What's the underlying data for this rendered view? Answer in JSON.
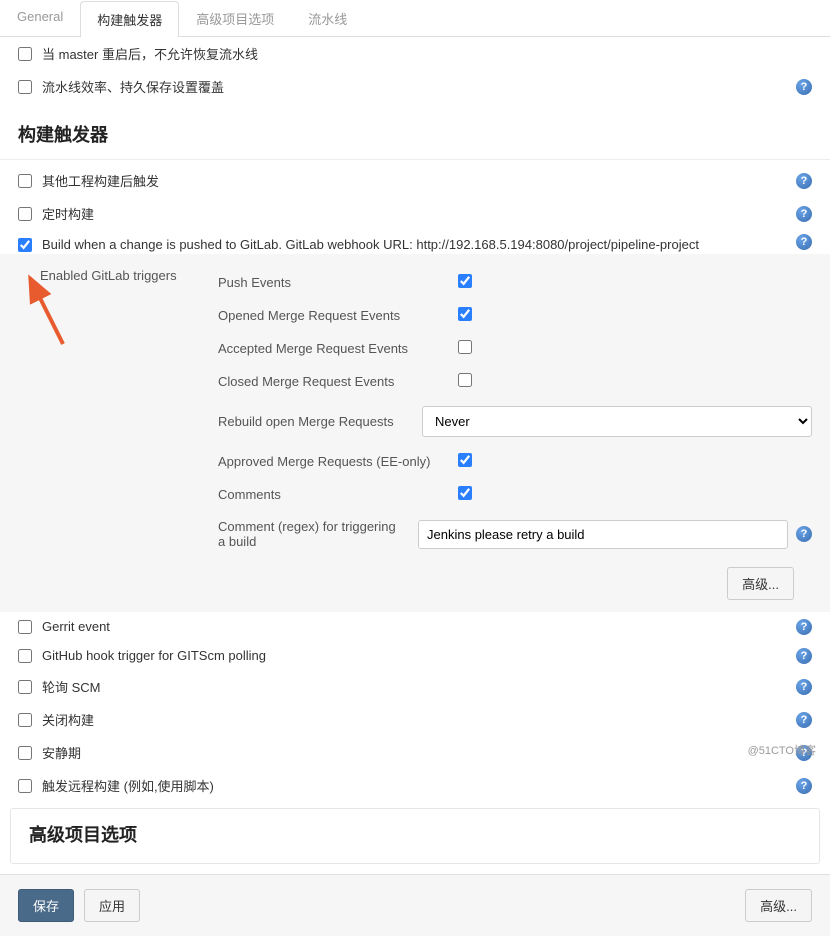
{
  "tabs": [
    {
      "label": "General"
    },
    {
      "label": "构建触发器"
    },
    {
      "label": "高级项目选项"
    },
    {
      "label": "流水线"
    }
  ],
  "top_checks": [
    {
      "label": "当 master 重启后，不允许恢复流水线",
      "checked": false,
      "help": false
    },
    {
      "label": "流水线效率、持久保存设置覆盖",
      "checked": false,
      "help": true
    }
  ],
  "section_title": "构建触发器",
  "trigger_checks": [
    {
      "label": "其他工程构建后触发",
      "checked": false,
      "help": true
    },
    {
      "label": "定时构建",
      "checked": false,
      "help": true
    }
  ],
  "gitlab": {
    "checked": true,
    "label": "Build when a change is pushed to GitLab. GitLab webhook URL: http://192.168.5.194:8080/project/pipeline-project",
    "enabled_label": "Enabled GitLab triggers",
    "rows": [
      {
        "label": "Push Events",
        "type": "check",
        "checked": true
      },
      {
        "label": "Opened Merge Request Events",
        "type": "check",
        "checked": true
      },
      {
        "label": "Accepted Merge Request Events",
        "type": "check",
        "checked": false
      },
      {
        "label": "Closed Merge Request Events",
        "type": "check",
        "checked": false
      },
      {
        "label": "Rebuild open Merge Requests",
        "type": "select",
        "value": "Never"
      },
      {
        "label": "Approved Merge Requests (EE-only)",
        "type": "check",
        "checked": true
      },
      {
        "label": "Comments",
        "type": "check",
        "checked": true
      },
      {
        "label": "Comment (regex) for triggering a build",
        "type": "text",
        "value": "Jenkins please retry a build",
        "help": true
      }
    ],
    "advanced_btn": "高级..."
  },
  "after_checks": [
    {
      "label": "Gerrit event",
      "checked": false,
      "help": true
    },
    {
      "label": "GitHub hook trigger for GITScm polling",
      "checked": false,
      "help": true
    },
    {
      "label": "轮询 SCM",
      "checked": false,
      "help": true
    },
    {
      "label": "关闭构建",
      "checked": false,
      "help": true
    },
    {
      "label": "安静期",
      "checked": false,
      "help": true
    },
    {
      "label": "触发远程构建 (例如,使用脚本)",
      "checked": false,
      "help": true
    }
  ],
  "advanced_section": "高级项目选项",
  "buttons": {
    "save": "保存",
    "apply": "应用",
    "advanced": "高级..."
  },
  "watermark": "@51CTO博客"
}
